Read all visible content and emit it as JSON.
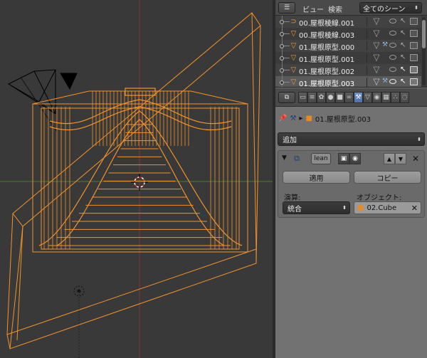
{
  "outliner": {
    "editor_icon": "☰",
    "view_menu": "ビュー",
    "search_menu": "検索",
    "scene_select": "全てのシーン",
    "rows": [
      {
        "name": "00.屋根稜線.001",
        "icon": "curve-icon",
        "glyph": "⊃",
        "selected": false
      },
      {
        "name": "00.屋根稜線.003",
        "icon": "mesh-icon",
        "glyph": "▽",
        "selected": false
      },
      {
        "name": "01.屋根原型.000",
        "icon": "mesh-icon",
        "glyph": "▽",
        "selected": false
      },
      {
        "name": "01.屋根原型.001",
        "icon": "mesh-icon",
        "glyph": "▽",
        "selected": false
      },
      {
        "name": "01.屋根原型.002",
        "icon": "mesh-icon",
        "glyph": "▽",
        "selected": false
      },
      {
        "name": "01.屋根原型.003",
        "icon": "mesh-icon",
        "glyph": "▽",
        "selected": true
      }
    ]
  },
  "properties": {
    "breadcrumb_object": "01.屋根原型.003",
    "add_modifier": "追加",
    "modifier": {
      "name": "lean",
      "apply_label": "適用",
      "copy_label": "コピー",
      "operation_label": "演算:",
      "operation_value": "統合",
      "object_label": "オブジェクト:",
      "object_value": "02.Cube"
    }
  },
  "colors": {
    "wire_selected": "#f4922a",
    "wire_active": "#ffb24a",
    "axis_x": "#a33a3a",
    "axis_y": "#4a7d2a"
  }
}
